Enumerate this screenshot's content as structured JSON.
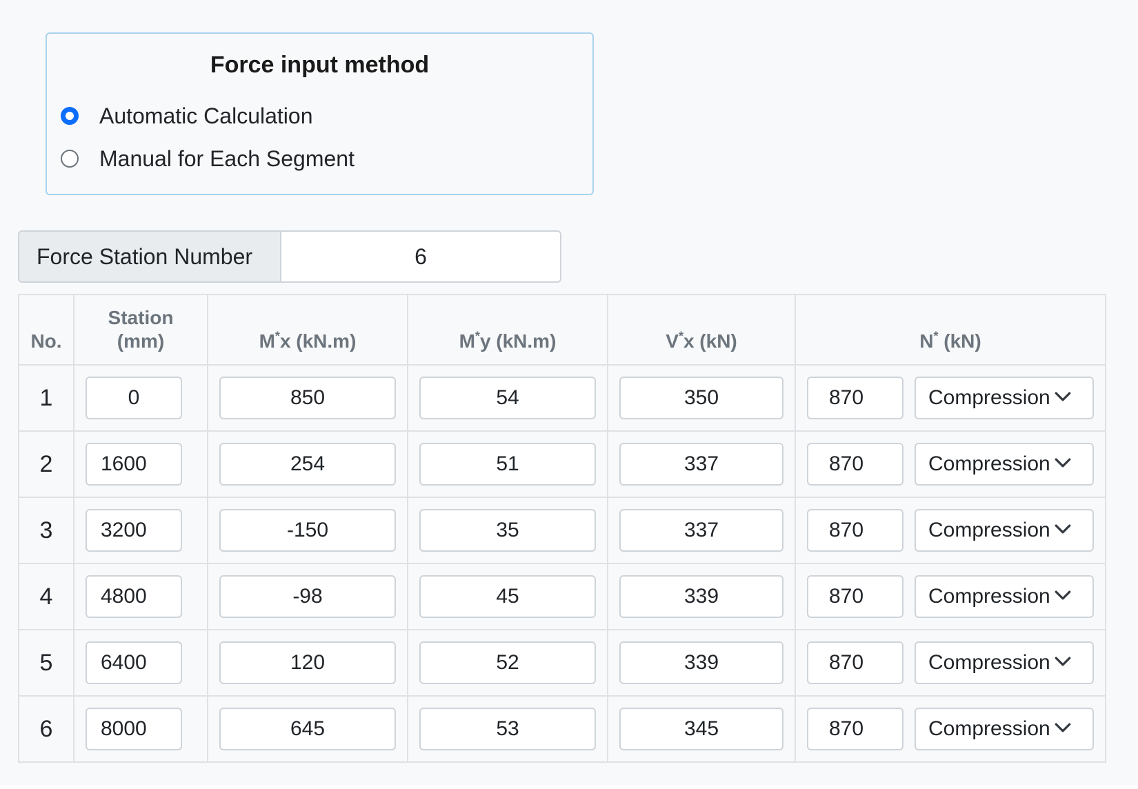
{
  "method": {
    "title": "Force input method",
    "options": [
      {
        "label": "Automatic Calculation",
        "checked": true
      },
      {
        "label": "Manual for Each Segment",
        "checked": false
      }
    ]
  },
  "station_number": {
    "label": "Force Station Number",
    "value": "6"
  },
  "table": {
    "headers": {
      "no": "No.",
      "station_line1": "Station",
      "station_line2": "(mm)",
      "mx_pre": "M",
      "mx_sup": "*",
      "mx_post": "x (kN.m)",
      "my_pre": "M",
      "my_sup": "*",
      "my_post": "y (kN.m)",
      "vx_pre": "V",
      "vx_sup": "*",
      "vx_post": "x (kN)",
      "n_pre": "N",
      "n_sup": "*",
      "n_post": " (kN)"
    },
    "rows": [
      {
        "no": "1",
        "station": "0",
        "mx": "850",
        "my": "54",
        "vx": "350",
        "n": "870",
        "type": "Compression"
      },
      {
        "no": "2",
        "station": "1600",
        "mx": "254",
        "my": "51",
        "vx": "337",
        "n": "870",
        "type": "Compression"
      },
      {
        "no": "3",
        "station": "3200",
        "mx": "-150",
        "my": "35",
        "vx": "337",
        "n": "870",
        "type": "Compression"
      },
      {
        "no": "4",
        "station": "4800",
        "mx": "-98",
        "my": "45",
        "vx": "339",
        "n": "870",
        "type": "Compression"
      },
      {
        "no": "5",
        "station": "6400",
        "mx": "120",
        "my": "52",
        "vx": "339",
        "n": "870",
        "type": "Compression"
      },
      {
        "no": "6",
        "station": "8000",
        "mx": "645",
        "my": "53",
        "vx": "345",
        "n": "870",
        "type": "Compression"
      }
    ]
  },
  "icons": {
    "select_chevron": "chevron-down-icon"
  },
  "colors": {
    "accent": "#0d6efd",
    "method_border": "#a9d3ee",
    "header_text": "#6c757d",
    "panel_bg": "#f8f9fa"
  }
}
